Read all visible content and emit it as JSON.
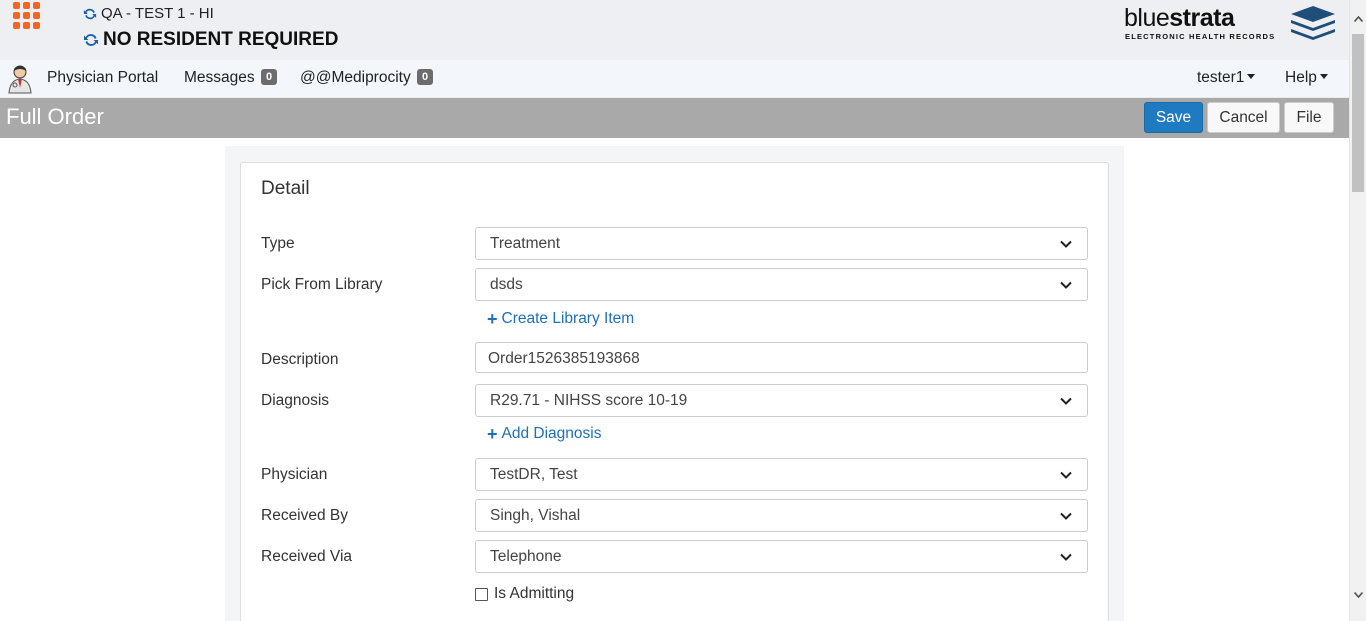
{
  "header": {
    "facility": "QA - TEST 1 - HI",
    "resident": "NO RESIDENT REQUIRED",
    "brand": {
      "name_light": "blue",
      "name_bold": "strata",
      "tagline": "ELECTRONIC HEALTH RECORDS",
      "icon": "stacked-layers-logo"
    },
    "apps_icon": "apps-grid-icon",
    "accent_color": "#f26522"
  },
  "nav": {
    "physician_portal": "Physician Portal",
    "messages_label": "Messages",
    "messages_count": "0",
    "mediprocity_label": "@@Mediprocity",
    "mediprocity_count": "0",
    "user": "tester1",
    "help": "Help"
  },
  "page": {
    "title": "Full Order",
    "save": "Save",
    "cancel": "Cancel",
    "file": "File",
    "primary_color": "#1f7bc1"
  },
  "form": {
    "section_title": "Detail",
    "type": {
      "label": "Type",
      "value": "Treatment"
    },
    "library": {
      "label": "Pick From Library",
      "value": "dsds",
      "create_link": "Create Library Item"
    },
    "description": {
      "label": "Description",
      "value": "Order1526385193868"
    },
    "diagnosis": {
      "label": "Diagnosis",
      "value": "R29.71 - NIHSS score 10-19",
      "add_link": "Add Diagnosis"
    },
    "physician": {
      "label": "Physician",
      "value": "TestDR, Test"
    },
    "received_by": {
      "label": "Received By",
      "value": "Singh, Vishal"
    },
    "received_via": {
      "label": "Received Via",
      "value": "Telephone"
    },
    "is_admitting": {
      "label": "Is Admitting",
      "checked": false
    }
  }
}
